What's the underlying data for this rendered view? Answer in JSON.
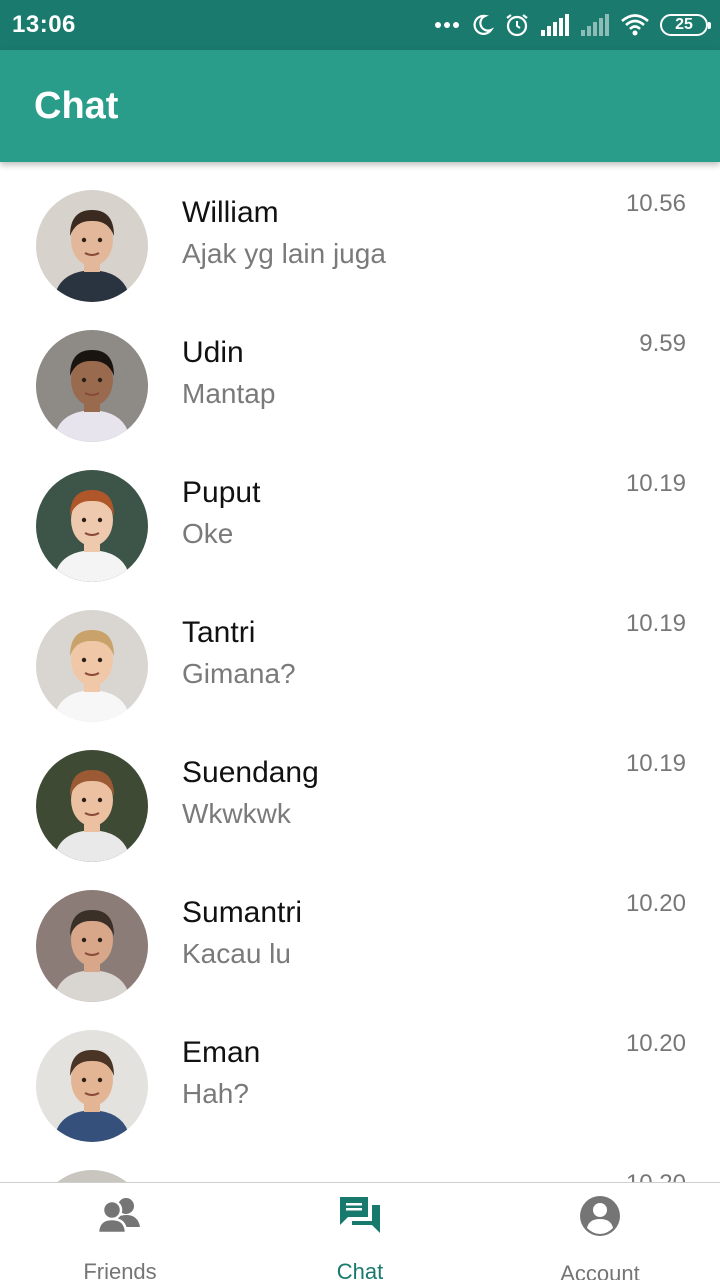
{
  "status_bar": {
    "time": "13:06",
    "battery": "25"
  },
  "app_bar": {
    "title": "Chat"
  },
  "chats": [
    {
      "name": "William",
      "message": "Ajak yg lain juga",
      "time": "10.56",
      "avatar_bg": "#d8d2cc",
      "skin": "#e2b79a",
      "hair": "#3a2a20",
      "shirt": "#2a3340"
    },
    {
      "name": "Udin",
      "message": "Mantap",
      "time": "9.59",
      "avatar_bg": "#8e8a86",
      "skin": "#9a6a4e",
      "hair": "#1a1410",
      "shirt": "#e8e4ee"
    },
    {
      "name": "Puput",
      "message": "Oke",
      "time": "10.19",
      "avatar_bg": "#3d5548",
      "skin": "#efc9ae",
      "hair": "#b0572a",
      "shirt": "#f4f4f4"
    },
    {
      "name": "Tantri",
      "message": "Gimana?",
      "time": "10.19",
      "avatar_bg": "#d9d6d2",
      "skin": "#f0c8a8",
      "hair": "#c9a26a",
      "shirt": "#f7f7f7"
    },
    {
      "name": "Suendang",
      "message": "Wkwkwk",
      "time": "10.19",
      "avatar_bg": "#3e4a34",
      "skin": "#ecc1a2",
      "hair": "#9c5a34",
      "shirt": "#e9e9ea"
    },
    {
      "name": "Sumantri",
      "message": "Kacau lu",
      "time": "10.20",
      "avatar_bg": "#8b7c78",
      "skin": "#d8a789",
      "hair": "#3b3028",
      "shirt": "#d9d5d1"
    },
    {
      "name": "Eman",
      "message": "Hah?",
      "time": "10.20",
      "avatar_bg": "#e4e2df",
      "skin": "#e3b594",
      "hair": "#4a3426",
      "shirt": "#35507a"
    },
    {
      "name": "",
      "message": "",
      "time": "10.20",
      "avatar_bg": "#c9c6c0",
      "skin": "#e6c2a6",
      "hair": "#b9a07a",
      "shirt": "#cccccc"
    }
  ],
  "bottom_nav": {
    "items": [
      {
        "label": "Friends",
        "icon": "friends-icon",
        "active": false
      },
      {
        "label": "Chat",
        "icon": "chat-icon",
        "active": true
      },
      {
        "label": "Account",
        "icon": "account-icon",
        "active": false
      }
    ]
  },
  "colors": {
    "status_bar": "#1a7a6d",
    "app_bar": "#2a9d8a",
    "active_nav": "#177a6c",
    "inactive_nav": "#757575"
  }
}
